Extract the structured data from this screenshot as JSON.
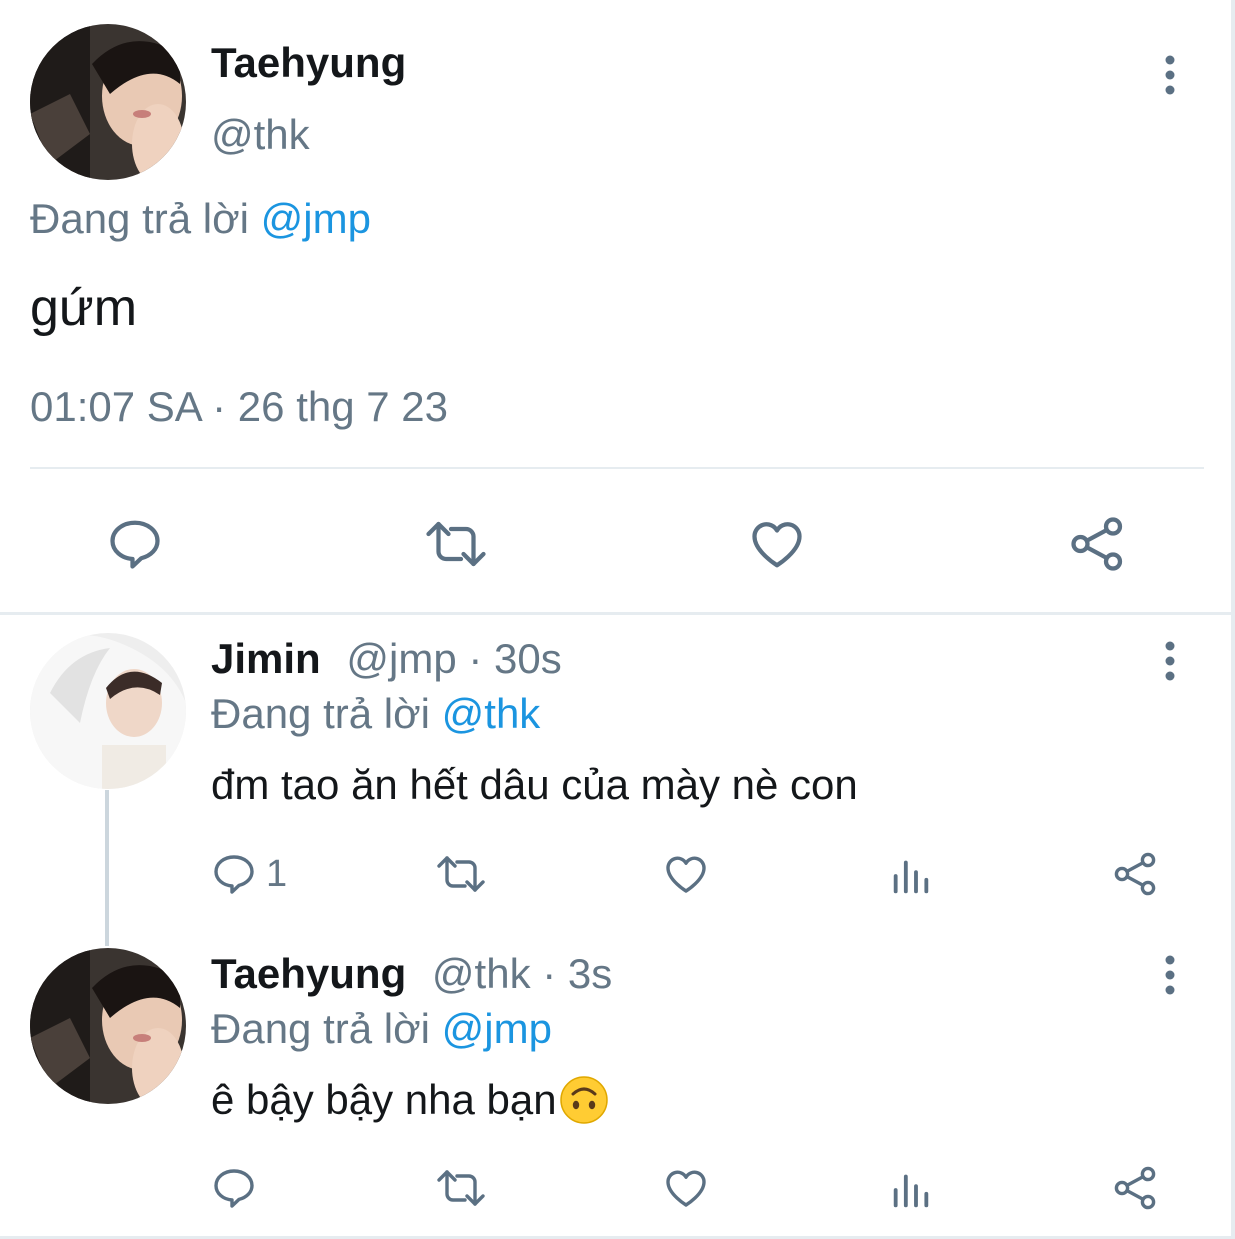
{
  "main_tweet": {
    "name": "Taehyung",
    "handle": "@thk",
    "replying_prefix": "Đang trả lời ",
    "replying_to": "@jmp",
    "text": "gứm",
    "timestamp": "01:07 SA · 26 thg 7 23",
    "actions": [
      "reply-icon",
      "retweet-icon",
      "like-icon",
      "share-icon"
    ]
  },
  "replies": [
    {
      "name": "Jimin",
      "handle_time": "@jmp · 30s",
      "replying_prefix": "Đang trả lời ",
      "replying_to": "@thk",
      "text": "đm tao ăn hết dâu của mày nè con",
      "reply_count": "1",
      "actions": [
        "reply-icon",
        "retweet-icon",
        "like-icon",
        "analytics-icon",
        "share-icon"
      ]
    },
    {
      "name": "Taehyung",
      "handle_time": "@thk · 3s",
      "replying_prefix": "Đang trả lời ",
      "replying_to": "@jmp",
      "text": "ê bậy bậy nha bạn",
      "emoji": "upside-down-face",
      "actions": [
        "reply-icon",
        "retweet-icon",
        "like-icon",
        "analytics-icon",
        "share-icon"
      ]
    }
  ],
  "colors": {
    "text": "#14171a",
    "secondary": "#657786",
    "link": "#1b95e0",
    "divider": "#e6ecf0",
    "icon": "#5b7083"
  }
}
